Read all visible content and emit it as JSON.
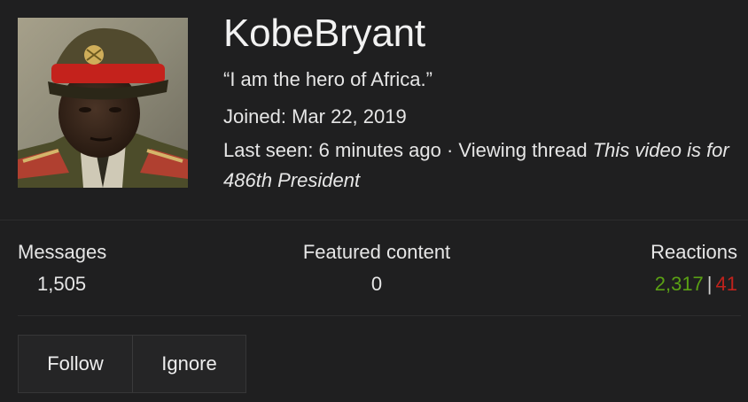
{
  "profile": {
    "username": "KobeBryant",
    "status": "“I am the hero of Africa.”",
    "joined_label": "Joined:",
    "joined_date": "Mar 22, 2019",
    "last_seen_label": "Last seen:",
    "last_seen_time": "6 minutes ago",
    "activity_separator": "·",
    "activity_text": "Viewing thread",
    "thread_title": "This video is for 486th President"
  },
  "stats": {
    "messages_label": "Messages",
    "messages_value": "1,505",
    "featured_label": "Featured content",
    "featured_value": "0",
    "reactions_label": "Reactions",
    "reactions_positive": "2,317",
    "reactions_separator": "|",
    "reactions_negative": "41"
  },
  "actions": {
    "follow_label": "Follow",
    "ignore_label": "Ignore"
  },
  "colors": {
    "background": "#1f1f20",
    "reaction_positive": "#5aa014",
    "reaction_negative": "#c0221c",
    "divider": "#2c2c2d"
  }
}
